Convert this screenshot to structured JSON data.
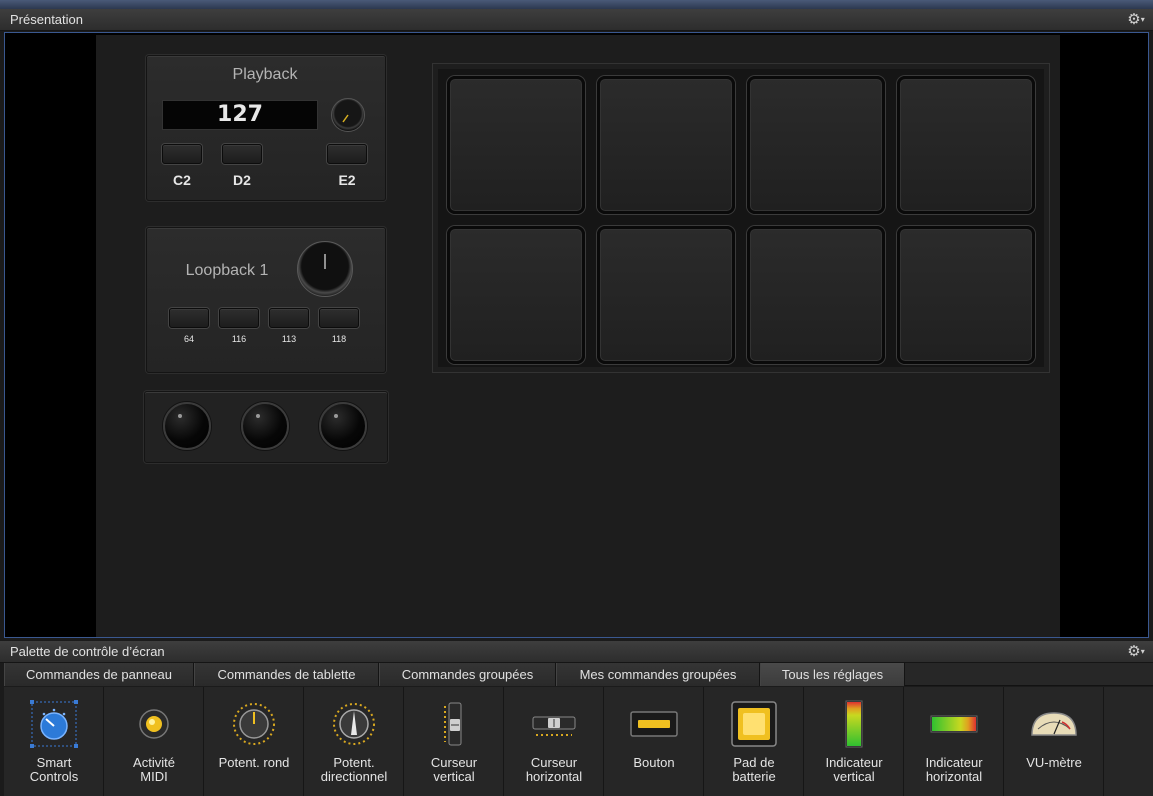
{
  "top_window": {
    "title": "Présentation",
    "gear_label": "⚙",
    "gear_caret": "▾"
  },
  "playback_panel": {
    "title": "Playback",
    "lcd_value": "127",
    "buttons": [
      "C2",
      "D2",
      "E2"
    ]
  },
  "loopback_panel": {
    "title": "Loopback 1",
    "buttons": [
      "64",
      "116",
      "113",
      "118"
    ]
  },
  "knob_group": {
    "count": 3
  },
  "drum_pads": {
    "rows": 2,
    "columns": 4
  },
  "palette_window": {
    "title": "Palette de contrôle d’écran",
    "gear_label": "⚙",
    "gear_caret": "▾",
    "tabs": [
      {
        "label": "Commandes de panneau",
        "active": false
      },
      {
        "label": "Commandes de tablette",
        "active": false
      },
      {
        "label": "Commandes groupées",
        "active": false
      },
      {
        "label": "Mes commandes groupées",
        "active": false
      },
      {
        "label": "Tous les réglages",
        "active": true
      }
    ],
    "items": [
      {
        "label": "Smart\nControls",
        "icon": "smart-controls-icon"
      },
      {
        "label": "Activité\nMIDI",
        "icon": "midi-activity-icon"
      },
      {
        "label": "Potent. rond",
        "icon": "round-knob-icon"
      },
      {
        "label": "Potent.\ndirectionnel",
        "icon": "directional-knob-icon"
      },
      {
        "label": "Curseur\nvertical",
        "icon": "vertical-slider-icon"
      },
      {
        "label": "Curseur\nhorizontal",
        "icon": "horizontal-slider-icon"
      },
      {
        "label": "Bouton",
        "icon": "button-icon"
      },
      {
        "label": "Pad de\nbatterie",
        "icon": "drum-pad-icon"
      },
      {
        "label": "Indicateur\nvertical",
        "icon": "vertical-meter-icon"
      },
      {
        "label": "Indicateur\nhorizontal",
        "icon": "horizontal-meter-icon"
      },
      {
        "label": "VU-mètre",
        "icon": "vu-meter-icon"
      }
    ]
  },
  "colors": {
    "selection_blue": "#3a7bd5",
    "accent_yellow": "#f0c020",
    "meter_green": "#3cc83c",
    "meter_red": "#e03030"
  }
}
